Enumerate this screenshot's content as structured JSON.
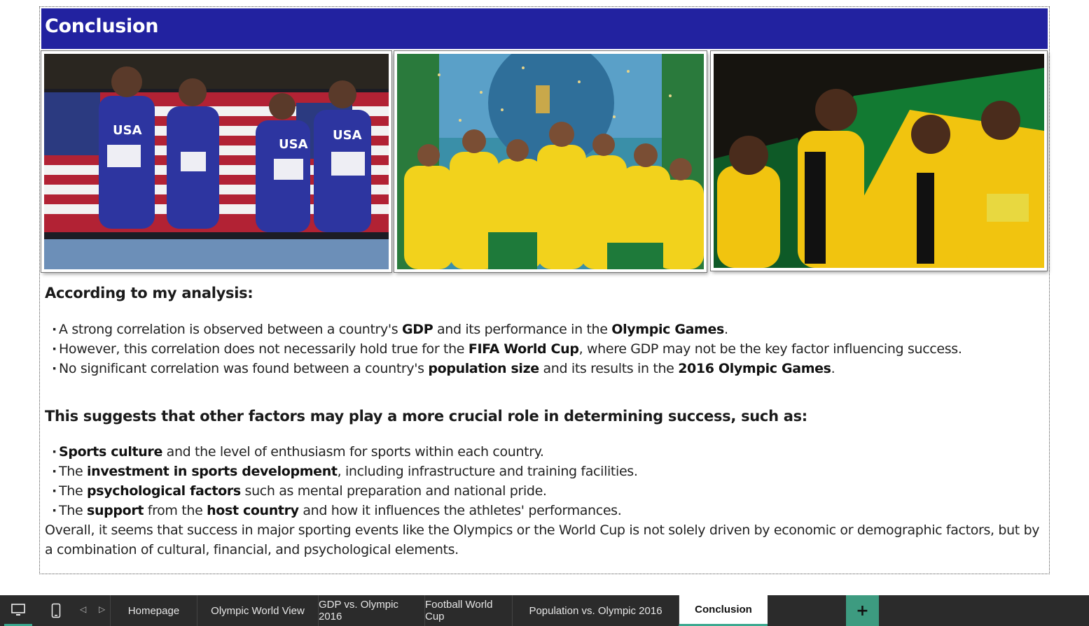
{
  "slide": {
    "title": "Conclusion",
    "heading1": "According to my analysis:",
    "findings": [
      {
        "parts": [
          [
            "A strong correlation is observed between a country's ",
            false
          ],
          [
            "GDP",
            true
          ],
          [
            " and its performance in the ",
            false
          ],
          [
            "Olympic Games",
            true
          ],
          [
            ".",
            false
          ]
        ]
      },
      {
        "parts": [
          [
            "However, this correlation does not necessarily hold true for the ",
            false
          ],
          [
            "FIFA World Cup",
            true
          ],
          [
            ", where GDP may not be the key factor influencing success.",
            false
          ]
        ]
      },
      {
        "parts": [
          [
            "No significant correlation was found between a country's ",
            false
          ],
          [
            "population size",
            true
          ],
          [
            " and its results in the ",
            false
          ],
          [
            "2016 Olympic Games",
            true
          ],
          [
            ".",
            false
          ]
        ]
      }
    ],
    "heading2": "This suggests that other factors may play a more crucial role in determining success, such as:",
    "factors": [
      {
        "parts": [
          [
            "Sports culture",
            true
          ],
          [
            " and the level of enthusiasm for sports within each country.",
            false
          ]
        ]
      },
      {
        "parts": [
          [
            "The ",
            false
          ],
          [
            "investment in sports development",
            true
          ],
          [
            ", including infrastructure and training facilities.",
            false
          ]
        ]
      },
      {
        "parts": [
          [
            "The ",
            false
          ],
          [
            "psychological factors",
            true
          ],
          [
            " such as mental preparation and national pride.",
            false
          ]
        ]
      },
      {
        "parts": [
          [
            "The ",
            false
          ],
          [
            "support",
            true
          ],
          [
            " from the ",
            false
          ],
          [
            "host country",
            true
          ],
          [
            " and how it influences the athletes' performances.",
            false
          ]
        ]
      }
    ],
    "summary": "Overall, it seems that success in major sporting events like the Olympics or the World Cup is not solely driven by economic or demographic factors, but by a combination of cultural, financial, and psychological elements."
  },
  "tabs": [
    "Homepage",
    "Olympic World View",
    "GDP vs. Olympic 2016",
    "Football World Cup",
    "Population vs. Olympic 2016",
    "Conclusion"
  ],
  "active_tab": "Conclusion",
  "add_tab_label": "+",
  "colors": {
    "title_bar": "#2222a0",
    "accent": "#3aa88f",
    "tabbar": "#2b2b2b"
  }
}
